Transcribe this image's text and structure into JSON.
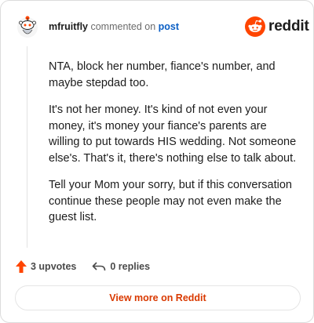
{
  "header": {
    "username": "mfruitfly",
    "action_text": "commented on",
    "post_link": "post"
  },
  "logo": {
    "wordmark": "reddit",
    "icon": "reddit-snoo-icon",
    "brand_color": "#ff4500"
  },
  "comment": {
    "paragraphs": [
      "NTA, block her number, fiance's number, and maybe stepdad too.",
      "It's not her money. It's kind of not even your money, it's money your fiance's parents are willing to put towards HIS wedding. Not someone else's. That's it, there's nothing else to talk about.",
      "Tell your Mom your sorry, but if this conversation continue these people may not even make the guest list."
    ]
  },
  "footer": {
    "upvotes": "3 upvotes",
    "replies": "0 replies",
    "upvote_icon": "upvote-arrow-icon",
    "reply_icon": "reply-arrow-icon",
    "upvote_color": "#ff4500"
  },
  "cta": {
    "label": "View more on Reddit",
    "color": "#d93900"
  }
}
